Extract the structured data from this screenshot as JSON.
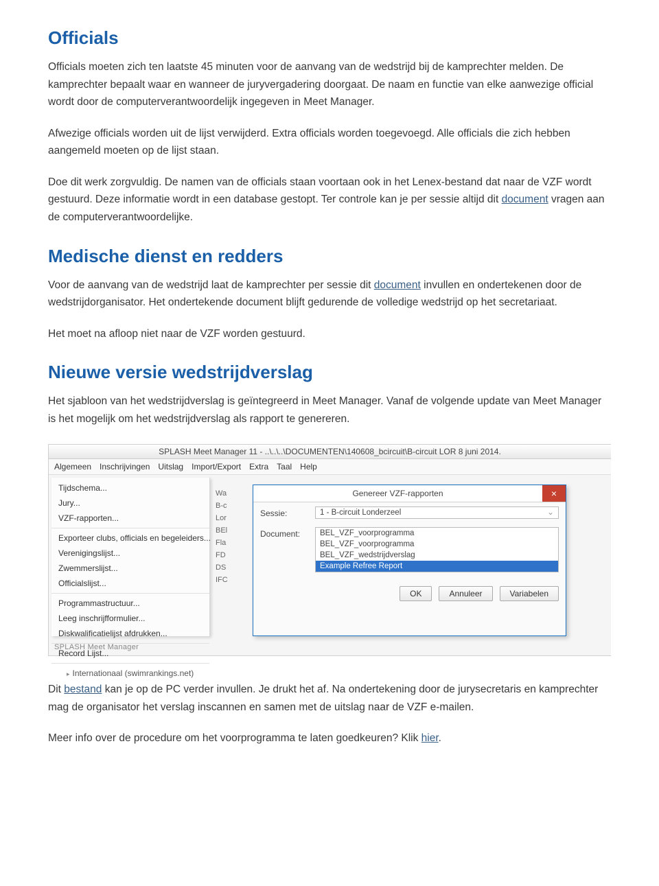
{
  "sections": {
    "officials": {
      "heading": "Officials",
      "p1": "Officials moeten zich ten laatste 45 minuten voor de aanvang van de wedstrijd bij de kamprechter melden. De kamprechter bepaalt waar en wanneer de juryvergadering doorgaat. De naam en functie van elke aanwezige official wordt door de computerverantwoordelijk ingegeven in Meet Manager.",
      "p2": "Afwezige officials worden uit de lijst verwijderd. Extra officials worden toegevoegd. Alle officials die zich hebben aangemeld moeten op de lijst staan.",
      "p3a": "Doe dit werk zorgvuldig. De namen van de officials staan voortaan ook in het Lenex-bestand dat naar de VZF wordt gestuurd. Deze informatie wordt in een database gestopt. Ter controle kan je per sessie altijd dit ",
      "p3_link": "document",
      "p3b": " vragen aan de computerverantwoordelijke."
    },
    "medisch": {
      "heading": "Medische dienst en redders",
      "p1a": "Voor de aanvang van de wedstrijd laat de kamprechter per sessie dit ",
      "p1_link": "document",
      "p1b": " invullen en ondertekenen door de wedstrijdorganisator. Het ondertekende document blijft gedurende de volledige wedstrijd op het secretariaat.",
      "p2": "Het moet na afloop niet naar de VZF worden gestuurd."
    },
    "nieuw": {
      "heading": "Nieuwe versie wedstrijdverslag",
      "p1": "Het sjabloon van het wedstrijdverslag is geïntegreerd in Meet Manager. Vanaf de volgende update van Meet Manager is het mogelijk om het wedstrijdverslag als rapport te genereren.",
      "p2a": "Dit ",
      "p2_link": "bestand",
      "p2b": " kan je op de PC verder invullen. Je drukt het af. Na ondertekening door de jurysecretaris en kamprechter mag de organisator het verslag inscannen en samen met de uitslag naar de VZF e-mailen.",
      "p3a": "Meer info over de procedure om het voorprogramma te laten goedkeuren? Klik ",
      "p3_link": "hier",
      "p3b": "."
    }
  },
  "screenshot": {
    "title": "SPLASH Meet Manager 11 - ..\\..\\..\\DOCUMENTEN\\140608_bcircuit\\B-circuit LOR 8 juni 2014.",
    "menubar": [
      "Algemeen",
      "Inschrijvingen",
      "Uitslag",
      "Import/Export",
      "Extra",
      "Taal",
      "Help"
    ],
    "left_menu": {
      "group1": [
        "Tijdschema...",
        "Jury...",
        "VZF-rapporten..."
      ],
      "group2": [
        "Exporteer clubs, officials en begeleiders...",
        "Verenigingslijst...",
        "Zwemmerslijst...",
        "Officialslijst..."
      ],
      "group3": [
        "Programmastructuur...",
        "Leeg inschrijfformulier...",
        "Diskwalificatielijst afdrukken..."
      ],
      "group4": [
        "Record Lijst..."
      ],
      "sub": "Internationaal (swimrankings.net)"
    },
    "col2": [
      "Wa",
      "B-c",
      "Lor",
      "BEl",
      "Fla",
      "FD",
      "DS",
      "IFC"
    ],
    "dialog": {
      "title": "Genereer VZF-rapporten",
      "sessie_label": "Sessie:",
      "sessie_value": "1 - B-circuit Londerzeel",
      "document_label": "Document:",
      "options": [
        "BEL_VZF_voorprogramma",
        "BEL_VZF_voorprogramma",
        "BEL_VZF_wedstrijdverslag",
        "Example Refree Report"
      ],
      "selected_index": 3,
      "buttons": {
        "ok": "OK",
        "cancel": "Annuleer",
        "vars": "Variabelen"
      }
    },
    "status": "SPLASH Meet Manager"
  }
}
